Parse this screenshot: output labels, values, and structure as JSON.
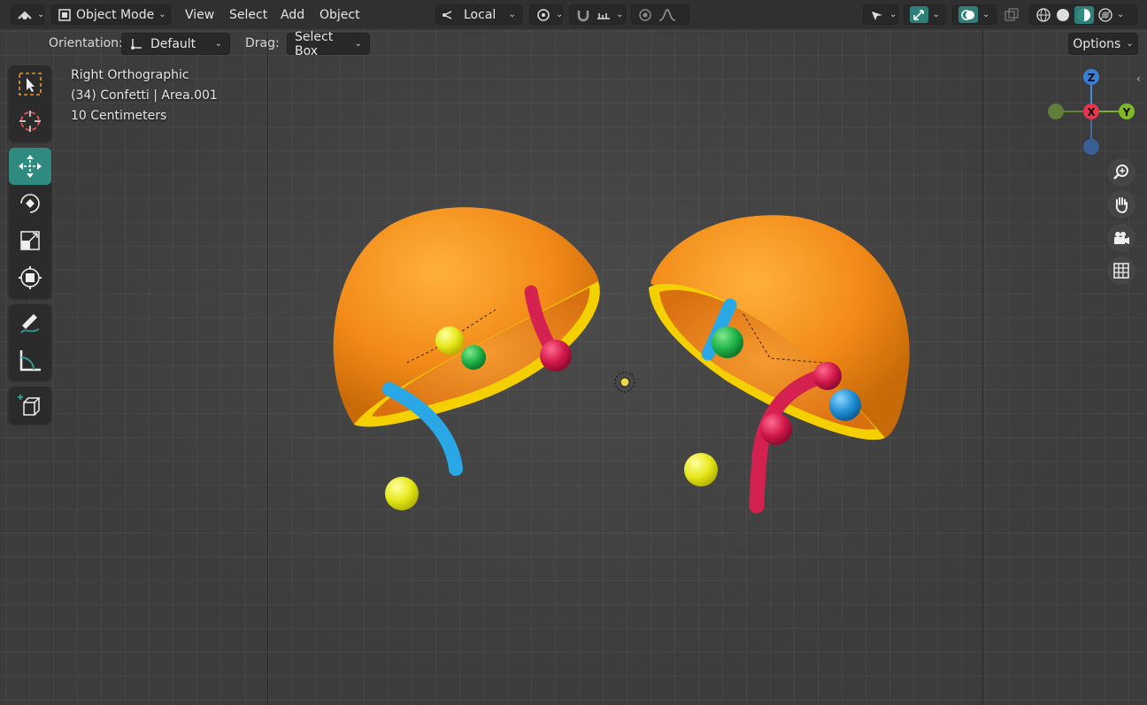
{
  "header": {
    "mode_label": "Object Mode",
    "menus": [
      "View",
      "Select",
      "Add",
      "Object"
    ],
    "pivot_label": "Local"
  },
  "tool_settings": {
    "orientation_label": "Orientation:",
    "orientation_value": "Default",
    "drag_label": "Drag:",
    "drag_value": "Select Box",
    "options_label": "Options"
  },
  "overlay": {
    "view_name": "Right Orthographic",
    "collection_info": "(34) Confetti | Area.001",
    "scale_info": "10 Centimeters"
  },
  "gizmo": {
    "z_label": "Z",
    "x_label": "X",
    "y_label": "Y"
  },
  "colors": {
    "accent": "#2f8a7f",
    "orange": "#f08a1c",
    "blue": "#3aa9e0",
    "red": "#d6224f",
    "green": "#27b34a",
    "yellow": "#e6e81c"
  },
  "toolbar_tools": [
    "select-box",
    "cursor",
    "move",
    "rotate",
    "scale",
    "transform",
    "annotate",
    "measure",
    "add-cube"
  ],
  "nav_icons": [
    "zoom-icon",
    "pan-hand-icon",
    "camera-icon",
    "grid-icon"
  ]
}
